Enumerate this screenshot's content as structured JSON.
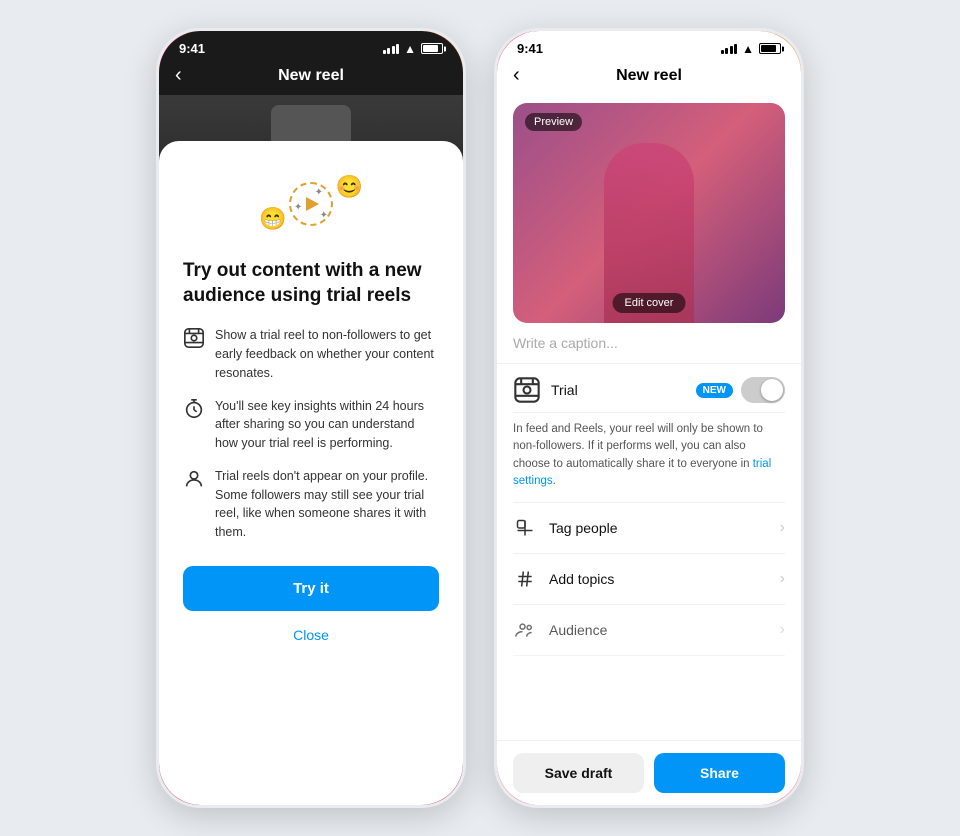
{
  "phone1": {
    "status": {
      "time": "9:41"
    },
    "nav": {
      "back_label": "‹",
      "title": "New reel"
    },
    "modal": {
      "heading": "Try out content with a new audience using trial reels",
      "features": [
        {
          "icon": "reel-icon",
          "text": "Show a trial reel to non-followers to get early feedback on whether your content resonates."
        },
        {
          "icon": "timer-icon",
          "text": "You'll see key insights within 24 hours after sharing so you can understand how your trial reel is performing."
        },
        {
          "icon": "profile-icon",
          "text": "Trial reels don't appear on your profile. Some followers may still see your trial reel, like when someone shares it with them."
        }
      ],
      "try_it_label": "Try it",
      "close_label": "Close"
    }
  },
  "phone2": {
    "status": {
      "time": "9:41"
    },
    "nav": {
      "back_label": "‹",
      "title": "New reel"
    },
    "preview": {
      "badge": "Preview",
      "edit_cover": "Edit cover"
    },
    "caption": {
      "placeholder": "Write a caption..."
    },
    "trial_section": {
      "label": "Trial",
      "new_badge": "NEW",
      "description": "In feed and Reels, your reel will only be shown to non-followers. If it performs well, you can also choose to automatically share it to everyone in ",
      "link_text": "trial settings",
      "description_end": "."
    },
    "settings_rows": [
      {
        "icon": "tag-icon",
        "label": "Tag people"
      },
      {
        "icon": "hashtag-icon",
        "label": "Add topics"
      },
      {
        "icon": "audience-icon",
        "label": "Audience"
      }
    ],
    "bottom": {
      "save_draft": "Save draft",
      "share": "Share"
    }
  },
  "colors": {
    "accent": "#0095f6",
    "gradient_start": "#f7406e",
    "gradient_end": "#ff8c00",
    "new_badge": "#0095f6"
  }
}
